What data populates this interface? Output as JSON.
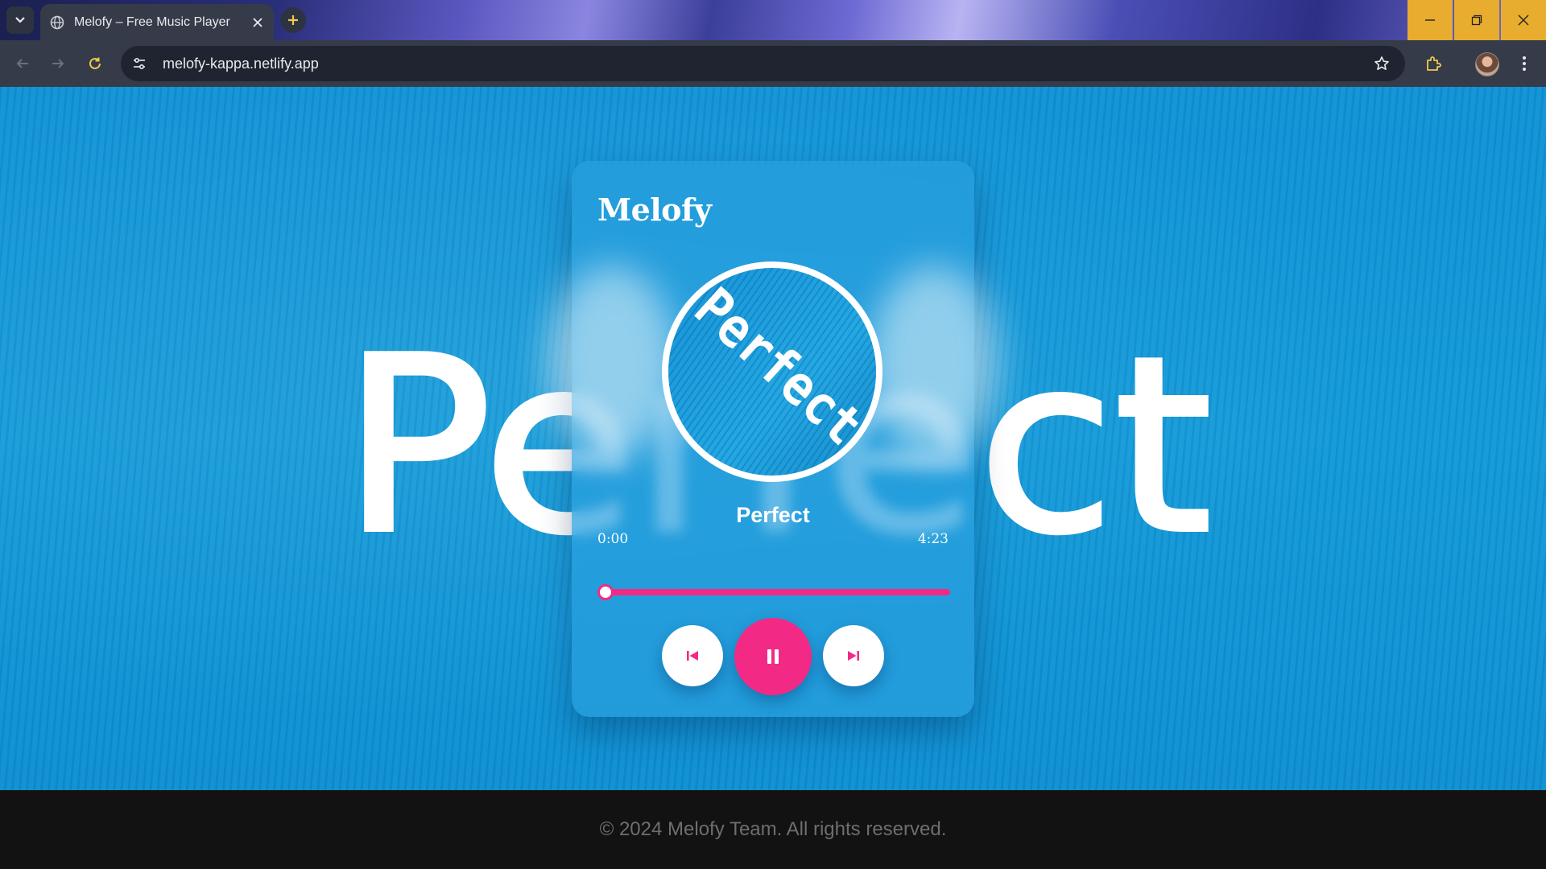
{
  "browser": {
    "tab_title": "Melofy – Free Music Player",
    "url": "melofy-kappa.netlify.app"
  },
  "page": {
    "background_word": "Perfect",
    "accent_color": "#f22a86",
    "background_color": "#0e92d6"
  },
  "player": {
    "brand": "Melofy",
    "album_art_text": "Perfect",
    "song_title": "Perfect",
    "current_time": "0:00",
    "duration": "4:23",
    "progress_fraction": 0,
    "controls": {
      "prev_icon": "skip-previous-icon",
      "play_icon": "pause-icon",
      "next_icon": "skip-next-icon"
    }
  },
  "footer": {
    "text": "© 2024 Melofy Team. All rights reserved."
  }
}
